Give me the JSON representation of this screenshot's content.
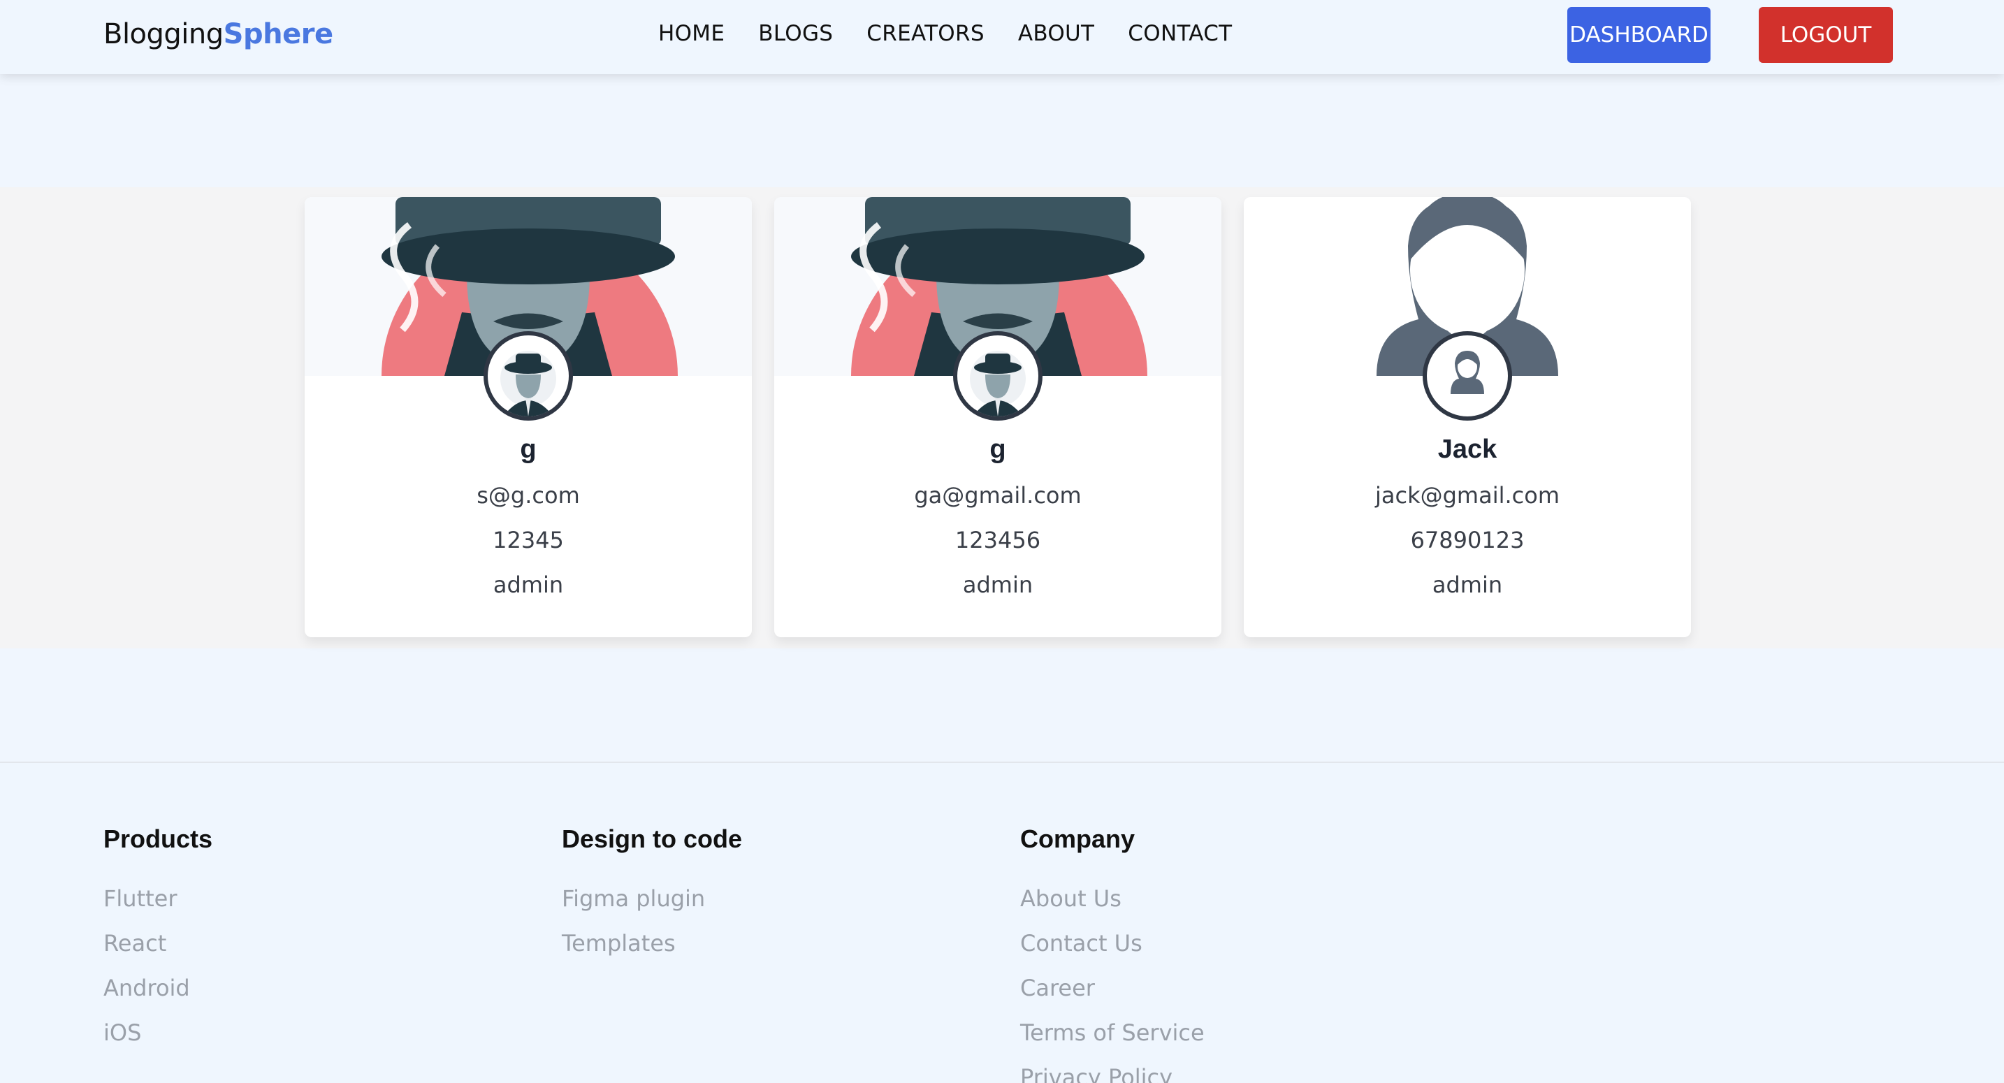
{
  "brand": {
    "part1": "Blogging",
    "part2": "Sphere"
  },
  "nav": {
    "links": [
      "HOME",
      "BLOGS",
      "CREATORS",
      "ABOUT",
      "CONTACT"
    ],
    "dashboard_label": "DASHBOARD",
    "logout_label": "LOGOUT"
  },
  "colors": {
    "brand_accent": "#4a78e0",
    "dashboard_button": "#3c63e3",
    "logout_button": "#d2312c"
  },
  "cards": [
    {
      "name": "g",
      "email": "s@g.com",
      "phone": "12345",
      "role": "admin",
      "avatar_icon": "detective-icon"
    },
    {
      "name": "g",
      "email": "ga@gmail.com",
      "phone": "123456",
      "role": "admin",
      "avatar_icon": "detective-icon"
    },
    {
      "name": "Jack",
      "email": "jack@gmail.com",
      "phone": "67890123",
      "role": "admin",
      "avatar_icon": "woman-avatar-icon"
    }
  ],
  "footer": {
    "columns": [
      {
        "title": "Products",
        "links": [
          "Flutter",
          "React",
          "Android",
          "iOS"
        ]
      },
      {
        "title": "Design to code",
        "links": [
          "Figma plugin",
          "Templates"
        ]
      },
      {
        "title": "Company",
        "links": [
          "About Us",
          "Contact Us",
          "Career",
          "Terms of Service",
          "Privacy Policy"
        ]
      }
    ]
  }
}
